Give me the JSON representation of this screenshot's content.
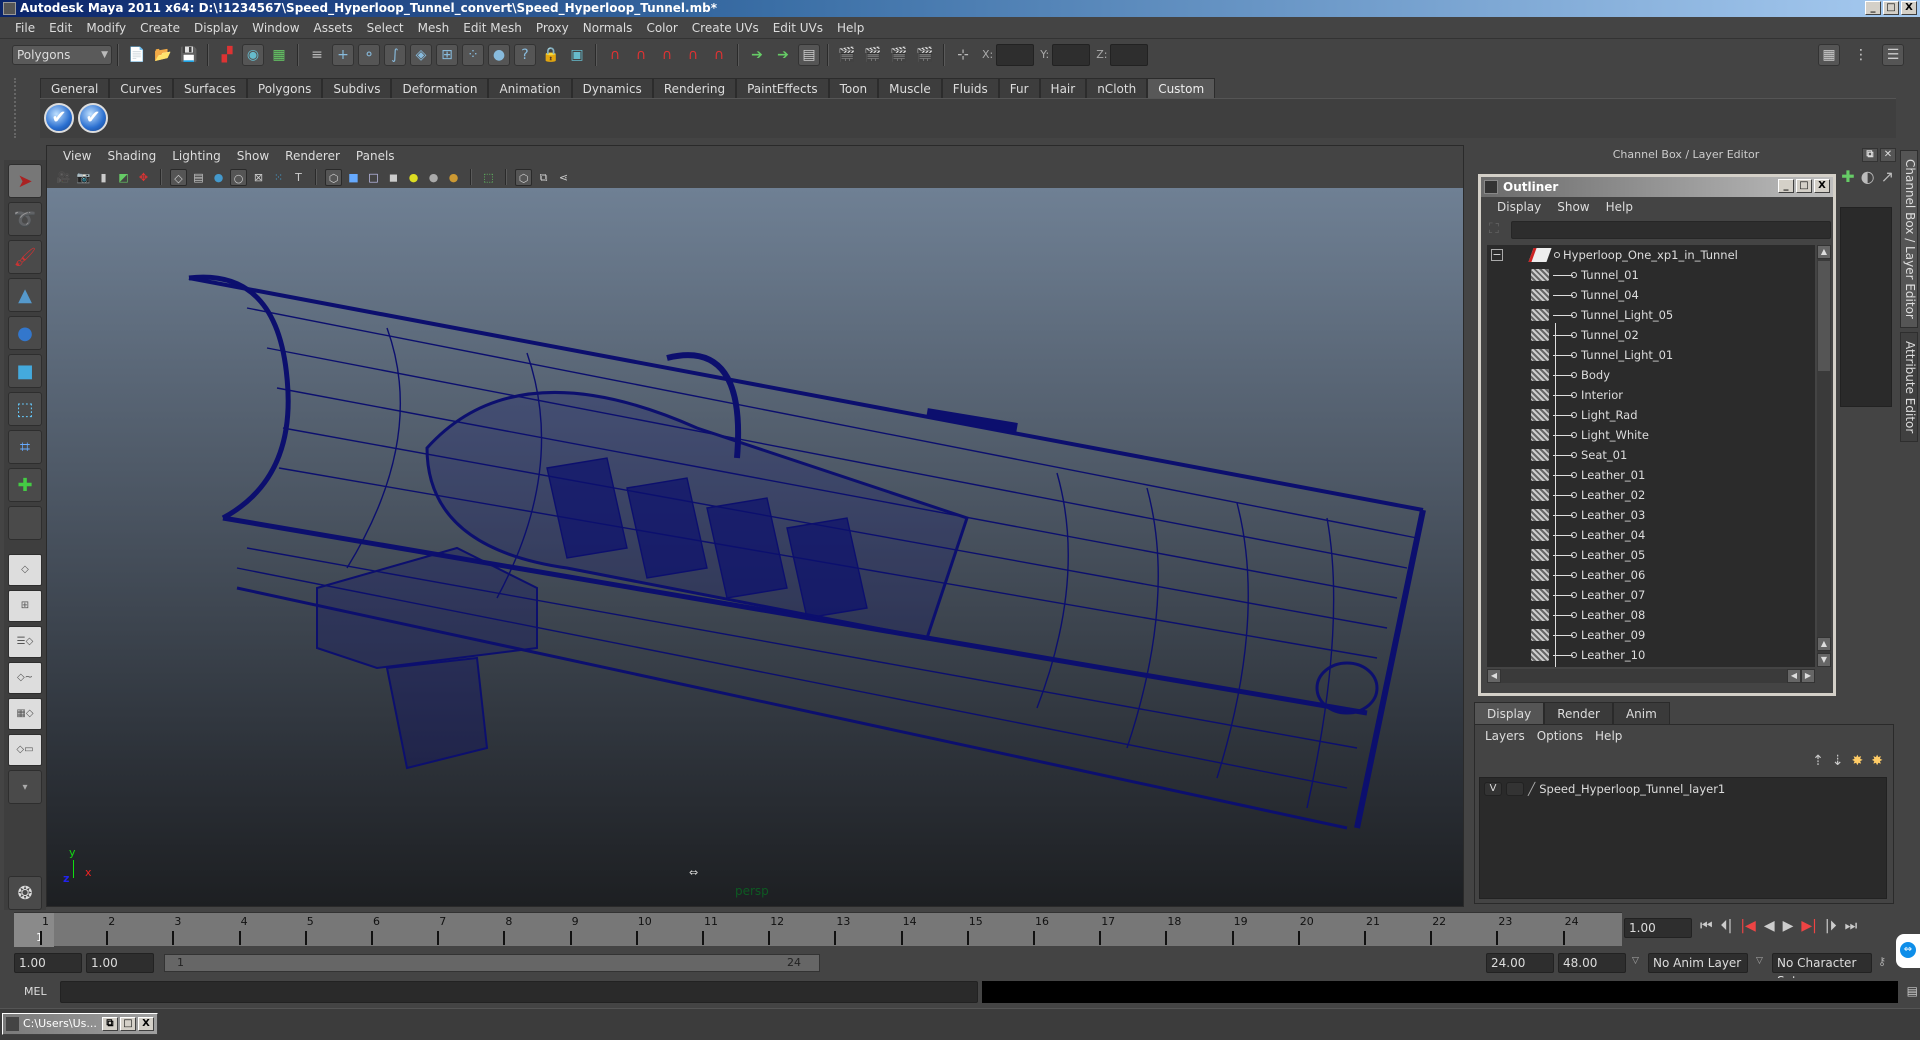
{
  "window": {
    "title": "Autodesk Maya 2011 x64: D:\\!1234567\\Speed_Hyperloop_Tunnel_convert\\Speed_Hyperloop_Tunnel.mb*",
    "minimize": "_",
    "maximize": "□",
    "close": "X"
  },
  "menubar": [
    "File",
    "Edit",
    "Modify",
    "Create",
    "Display",
    "Window",
    "Assets",
    "Select",
    "Mesh",
    "Edit Mesh",
    "Proxy",
    "Normals",
    "Color",
    "Create UVs",
    "Edit UVs",
    "Help"
  ],
  "toolbar": {
    "menu_set": "Polygons",
    "icons": [
      "new-scene-icon",
      "open-scene-icon",
      "save-scene-icon",
      "select-hierarchy-icon",
      "select-object-icon",
      "select-component-icon",
      "select-by-type-icon",
      "vertex-mask-icon",
      "edge-mask-icon",
      "curve-mask-icon",
      "face-mask-icon",
      "uv-mask-icon",
      "point-mask-icon",
      "misc-mask-icon",
      "lock-icon",
      "highlight-selection-icon",
      "snap-grid-icon",
      "snap-curve-icon",
      "snap-point-icon",
      "snap-view-plane-icon",
      "snap-live-icon",
      "input-ops-icon",
      "output-ops-icon",
      "history-icon",
      "render-view-icon",
      "render-icon",
      "ipr-render-icon",
      "render-settings-icon"
    ],
    "coord_labels": {
      "x": "X:",
      "y": "Y:",
      "z": "Z:"
    }
  },
  "shelf": {
    "tabs": [
      "General",
      "Curves",
      "Surfaces",
      "Polygons",
      "Subdivs",
      "Deformation",
      "Animation",
      "Dynamics",
      "Rendering",
      "PaintEffects",
      "Toon",
      "Muscle",
      "Fluids",
      "Fur",
      "Hair",
      "nCloth",
      "Custom"
    ],
    "active_tab": "Custom",
    "buttons": [
      "✔",
      "✔"
    ]
  },
  "viewport": {
    "menu": [
      "View",
      "Shading",
      "Lighting",
      "Show",
      "Renderer",
      "Panels"
    ],
    "camera_label": "persp",
    "axis": {
      "x": "x",
      "y": "y",
      "z": "z"
    },
    "wireframe_color": "#0c0f6e"
  },
  "channel_box": {
    "header": "Channel Box / Layer Editor"
  },
  "side_tabs": [
    "Channel Box / Layer Editor",
    "Attribute Editor"
  ],
  "outliner": {
    "title": "Outliner",
    "menu": [
      "Display",
      "Show",
      "Help"
    ],
    "root": "Hyperloop_One_xp1_in_Tunnel",
    "items": [
      "Tunnel_01",
      "Tunnel_04",
      "Tunnel_Light_05",
      "Tunnel_02",
      "Tunnel_Light_01",
      "Body",
      "Interior",
      "Light_Rad",
      "Light_White",
      "Seat_01",
      "Leather_01",
      "Leather_02",
      "Leather_03",
      "Leather_04",
      "Leather_05",
      "Leather_06",
      "Leather_07",
      "Leather_08",
      "Leather_09",
      "Leather_10"
    ]
  },
  "layer_editor": {
    "tabs": [
      "Display",
      "Render",
      "Anim"
    ],
    "active_tab": "Display",
    "menu": [
      "Layers",
      "Options",
      "Help"
    ],
    "layers": [
      {
        "visible": "V",
        "name": "Speed_Hyperloop_Tunnel_layer1"
      }
    ]
  },
  "timeline": {
    "frames": [
      "1",
      "2",
      "3",
      "4",
      "5",
      "6",
      "7",
      "8",
      "9",
      "10",
      "11",
      "12",
      "13",
      "14",
      "15",
      "16",
      "17",
      "18",
      "19",
      "20",
      "21",
      "22",
      "23",
      "24"
    ],
    "current_frame_marker": "1",
    "current_time": "1.00"
  },
  "range": {
    "start_time": "1.00",
    "playback_start": "1.00",
    "range_start": "1",
    "range_end": "24",
    "playback_end": "24.00",
    "end_time": "48.00",
    "anim_layer": "No Anim Layer",
    "character_set": "No Character Set"
  },
  "command_line": {
    "label": "MEL"
  },
  "taskbar": {
    "item": "C:\\Users\\Us..."
  }
}
